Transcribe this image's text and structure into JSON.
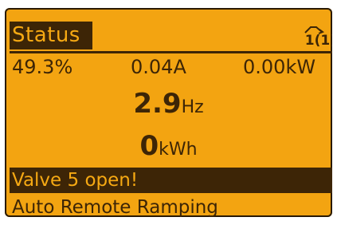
{
  "display": {
    "title": "Status",
    "setup_indicator": "1(1)",
    "readouts": [
      {
        "value": "49.3%"
      },
      {
        "value": "0.04A"
      },
      {
        "value": "0.00kW"
      }
    ],
    "frequency": {
      "value": "2.9",
      "unit": "Hz"
    },
    "energy": {
      "value": "0",
      "unit": "kWh"
    },
    "alarm_message": "Valve 5 open!",
    "status_line": "Auto Remote Ramping",
    "colors": {
      "background": "#f3a411",
      "foreground": "#3d2506"
    }
  }
}
